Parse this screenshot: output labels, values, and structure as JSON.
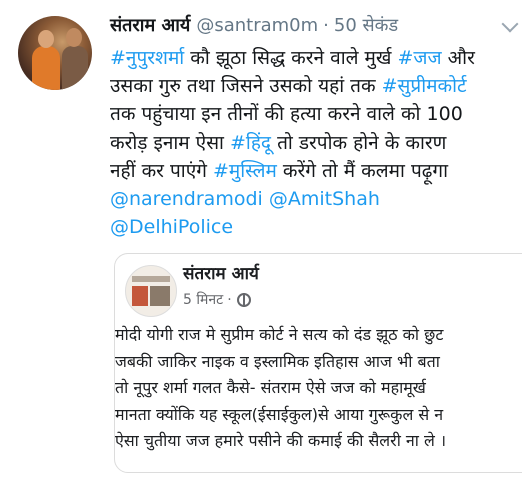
{
  "tweet": {
    "author_name": "संतराम आर्य",
    "handle": "@santram0m",
    "separator": "·",
    "time": "50 सेकंड",
    "lines": [
      [
        {
          "t": "#नुपुरशर्मा",
          "k": "tag"
        },
        {
          "t": " कौ झूठा सिद्ध करने वाले मुर्ख ",
          "k": "text"
        },
        {
          "t": "#जज",
          "k": "tag"
        },
        {
          "t": " और",
          "k": "text"
        }
      ],
      [
        {
          "t": "उसका गुरु तथा जिसने उसको यहां तक ",
          "k": "text"
        },
        {
          "t": "#सुप्रीमकोर्ट",
          "k": "tag"
        }
      ],
      [
        {
          "t": "तक पहुंचाया इन तीनों की हत्या करने वाले को 100",
          "k": "text"
        }
      ],
      [
        {
          "t": "करोड़ इनाम ऐसा ",
          "k": "text"
        },
        {
          "t": "#हिंदू",
          "k": "tag"
        },
        {
          "t": " तो डरपोक होने के कारण",
          "k": "text"
        }
      ],
      [
        {
          "t": "नहीं कर पाएंगे ",
          "k": "text"
        },
        {
          "t": "#मुस्लिम",
          "k": "tag"
        },
        {
          "t": " करेंगे तो मैं कलमा पढ़ूगा",
          "k": "text"
        }
      ],
      [
        {
          "t": "@narendramodi",
          "k": "mention"
        },
        {
          "t": " ",
          "k": "text"
        },
        {
          "t": "@AmitShah",
          "k": "mention"
        }
      ],
      [
        {
          "t": "@DelhiPolice",
          "k": "mention"
        }
      ]
    ]
  },
  "card": {
    "author_name": "संतराम आर्य",
    "time": "5 मिनट",
    "separator": "·",
    "lines": [
      "मोदी योगी राज मे सुप्रीम कोर्ट ने सत्य को दंड झूठ को छुट",
      "जबकी जाकिर नाइक व इस्लामिक इतिहास आज भी बता",
      "तो नूपुर शर्मा गलत कैसे- संतराम ऐसे जज को महामूर्ख",
      "मानता क्योंकि यह स्कूल(ईसाईकुल)से आया गुरूकुल से न",
      "ऐसा चुतीया जज हमारे पसीने की कमाई की सैलरी ना ले ।"
    ]
  },
  "colors": {
    "link": "#1d9bf0",
    "muted": "#657786",
    "text": "#14171a"
  }
}
